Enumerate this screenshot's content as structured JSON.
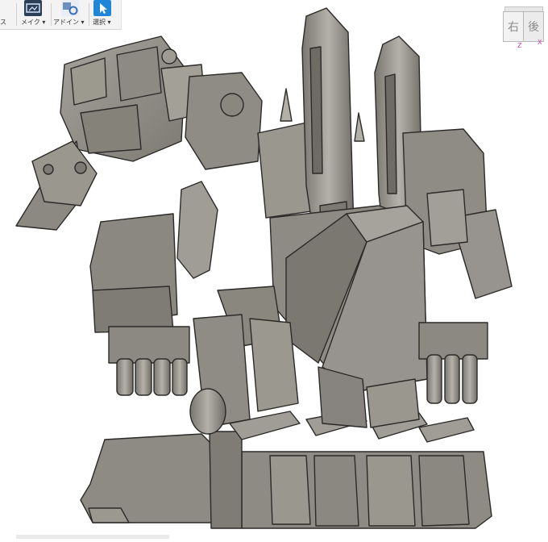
{
  "app": {
    "toolbar": {
      "partial_label": "ス",
      "groups": [
        {
          "label": "メイク ▾",
          "icon": "mesh-make-icon"
        },
        {
          "label": "アドイン ▾",
          "icon": "addins-gear-icon"
        },
        {
          "label": "選択 ▾",
          "icon": "select-cursor-icon"
        }
      ]
    },
    "viewcube": {
      "left_face": "右",
      "right_face": "後",
      "axis_z": "Z",
      "axis_x": "X"
    }
  },
  "colors": {
    "model_fill": "#8e8b84",
    "model_light": "#a19e97",
    "model_dark": "#6d6a64",
    "edge": "#2b2a28",
    "select_active": "#1f86d9",
    "axis": "#d63aa8"
  }
}
